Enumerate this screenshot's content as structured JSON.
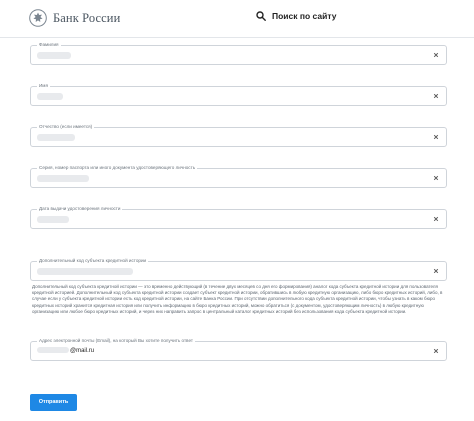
{
  "header": {
    "logo_text": "Банк России",
    "search_label": "Поиск по сайту"
  },
  "form": {
    "fields": [
      {
        "label": "Фамилия",
        "value": ""
      },
      {
        "label": "Имя",
        "value": ""
      },
      {
        "label": "Отчество (если имеется)",
        "value": ""
      },
      {
        "label": "Серия, номер паспорта или иного документа удостоверяющего личность",
        "value": ""
      },
      {
        "label": "Дата выдачи удостоверения личности",
        "value": ""
      },
      {
        "label": "Дополнительный код субъекта кредитной истории",
        "value": ""
      },
      {
        "label": "Адрес электронной почты (Email), на который Вы хотите получить ответ",
        "value": "@mail.ru"
      }
    ],
    "help_text": "Дополнительный код субъекта кредитной истории — это временно действующий (в течение двух месяцев со дня его формирования) аналог кода субъекта кредитной истории для пользователя кредитной историей. Дополнительный код субъекта кредитной истории создает субъект кредитной истории, обратившись в любую кредитную организацию, либо бюро кредитных историй, либо, в случае если у субъекта кредитной истории есть код кредитной истории, на сайте Банка России. При отсутствии дополнительного кода субъекта кредитной истории, чтобы узнать в каком бюро кредитных историй хранится кредитная история или получить информацию в бюро кредитных историй, можно обратиться (с документом, удостоверяющим личность) в любую кредитную организацию или любое бюро кредитных историй, и через них направить запрос в центральный каталог кредитных историй без использования кода субъекта кредитной истории.",
    "submit_label": "Отправить"
  },
  "colors": {
    "accent": "#1e88e5",
    "border": "#cfd4da"
  }
}
